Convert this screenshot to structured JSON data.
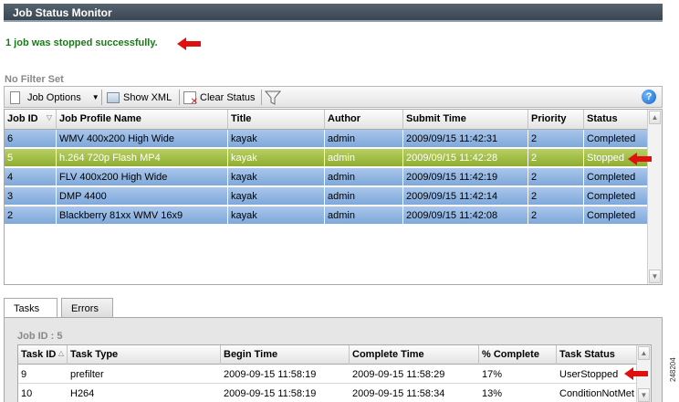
{
  "window": {
    "title": "Job Status Monitor"
  },
  "message": "1 job was stopped successfully.",
  "filter_label": "No Filter Set",
  "toolbar": {
    "job_options_label": "Job Options",
    "show_xml_label": "Show XML",
    "clear_status_label": "Clear Status",
    "help_label": "?"
  },
  "jobs_table": {
    "columns": [
      "Job ID",
      "Job Profile Name",
      "Title",
      "Author",
      "Submit Time",
      "Priority",
      "Status"
    ],
    "rows": [
      [
        "6",
        "WMV 400x200 High Wide",
        "kayak",
        "admin",
        "2009/09/15 11:42:31",
        "2",
        "Completed"
      ],
      [
        "5",
        "h.264 720p Flash MP4",
        "kayak",
        "admin",
        "2009/09/15 11:42:28",
        "2",
        "Stopped"
      ],
      [
        "4",
        "FLV 400x200 High Wide",
        "kayak",
        "admin",
        "2009/09/15 11:42:19",
        "2",
        "Completed"
      ],
      [
        "3",
        "DMP 4400",
        "kayak",
        "admin",
        "2009/09/15 11:42:14",
        "2",
        "Completed"
      ],
      [
        "2",
        "Blackberry 81xx WMV 16x9",
        "kayak",
        "admin",
        "2009/09/15 11:42:08",
        "2",
        "Completed"
      ]
    ],
    "selected_row": 1
  },
  "tabs": [
    "Tasks",
    "Errors"
  ],
  "tasks_panel": {
    "job_id_label": "Job ID : 5",
    "columns": [
      "Task ID",
      "Task Type",
      "Begin Time",
      "Complete Time",
      "% Complete",
      "Task Status"
    ],
    "rows": [
      [
        "9",
        "prefilter",
        "2009-09-15 11:58:19",
        "2009-09-15 11:58:29",
        "17%",
        "UserStopped"
      ],
      [
        "10",
        "H264",
        "2009-09-15 11:58:19",
        "2009-09-15 11:58:34",
        "13%",
        "ConditionNotMet"
      ]
    ]
  },
  "figure_id": "248204",
  "colors": {
    "success_text": "#1a7a1a",
    "row_blue": "#7ea8db",
    "row_selected_green": "#8eae2f",
    "arrow_red": "#e01010"
  }
}
